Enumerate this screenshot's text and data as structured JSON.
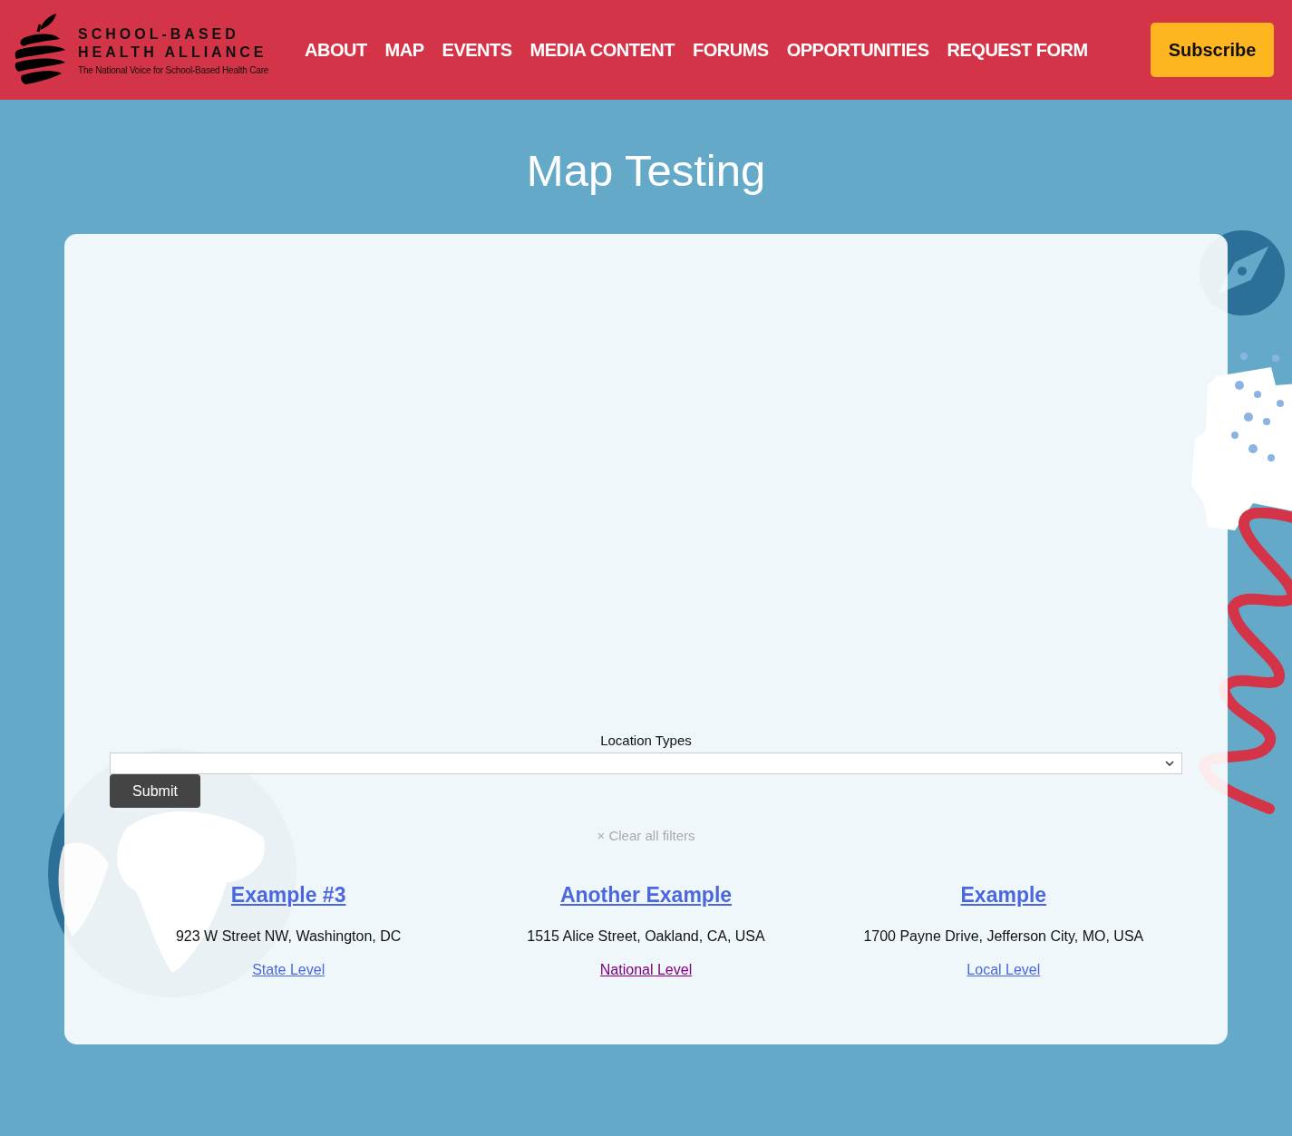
{
  "header": {
    "logo": {
      "line_1": "SCHOOL-BASED",
      "line_2": "HEALTH ALLIANCE",
      "tagline": "The National Voice for School-Based Health Care"
    },
    "nav": [
      {
        "label": "ABOUT"
      },
      {
        "label": "MAP"
      },
      {
        "label": "EVENTS"
      },
      {
        "label": "MEDIA CONTENT"
      },
      {
        "label": "FORUMS"
      },
      {
        "label": "OPPORTUNITIES"
      },
      {
        "label": "REQUEST FORM"
      }
    ],
    "subscribe": "Subscribe"
  },
  "page_title": "Map Testing",
  "filters": {
    "label": "Location Types",
    "submit": "Submit",
    "clear": "× Clear all filters"
  },
  "results": [
    {
      "name": "Example #3",
      "address": "923 W Street NW, Washington, DC",
      "level": "State Level",
      "visited": false
    },
    {
      "name": "Another Example",
      "address": "1515 Alice Street, Oakland, CA, USA",
      "level": "National Level",
      "visited": true
    },
    {
      "name": "Example",
      "address": "1700 Payne Drive, Jefferson City, MO, USA",
      "level": "Local Level",
      "visited": false
    }
  ]
}
